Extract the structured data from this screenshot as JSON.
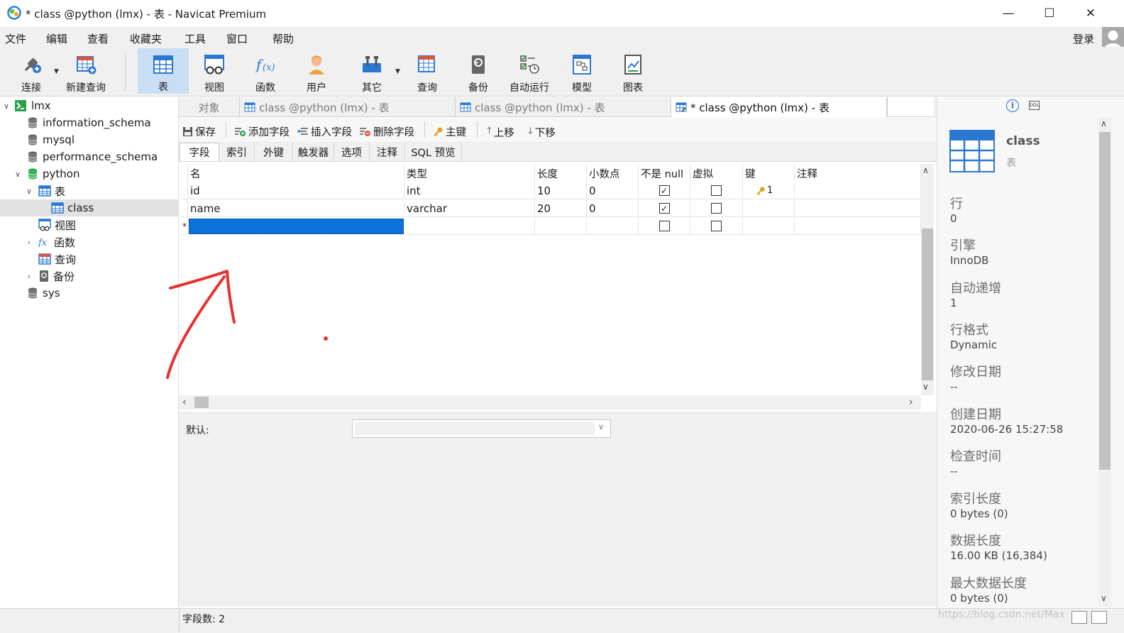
{
  "window": {
    "title": "* class @python (lmx) - 表 - Navicat Premium",
    "min_glyph": "—",
    "max_glyph": "☐",
    "close_glyph": "✕"
  },
  "menu": [
    "文件",
    "编辑",
    "查看",
    "收藏夹",
    "工具",
    "窗口",
    "帮助"
  ],
  "login": "登录",
  "toolbar": [
    {
      "label": "连接",
      "icon": "connect-icon"
    },
    {
      "label": "新建查询",
      "icon": "new-query-icon"
    },
    {
      "label": "表",
      "icon": "table-icon",
      "active": true
    },
    {
      "label": "视图",
      "icon": "view-icon"
    },
    {
      "label": "函数",
      "icon": "function-icon"
    },
    {
      "label": "用户",
      "icon": "user-icon"
    },
    {
      "label": "其它",
      "icon": "tools-icon"
    },
    {
      "label": "查询",
      "icon": "query-icon"
    },
    {
      "label": "备份",
      "icon": "backup-icon"
    },
    {
      "label": "自动运行",
      "icon": "automation-icon"
    },
    {
      "label": "模型",
      "icon": "model-icon"
    },
    {
      "label": "图表",
      "icon": "chart-icon"
    }
  ],
  "tree": [
    {
      "label": "lmx",
      "icon": "connection-icon"
    },
    {
      "label": "information_schema",
      "icon": "database-icon"
    },
    {
      "label": "mysql",
      "icon": "database-icon"
    },
    {
      "label": "performance_schema",
      "icon": "database-icon"
    },
    {
      "label": "python",
      "icon": "database-open-icon"
    },
    {
      "label": "表",
      "icon": "tables-folder-icon"
    },
    {
      "label": "class",
      "icon": "table-item-icon"
    },
    {
      "label": "视图",
      "icon": "views-folder-icon"
    },
    {
      "label": "函数",
      "icon": "functions-folder-icon"
    },
    {
      "label": "查询",
      "icon": "queries-folder-icon"
    },
    {
      "label": "备份",
      "icon": "backups-folder-icon"
    },
    {
      "label": "sys",
      "icon": "database-icon"
    }
  ],
  "tabs": [
    {
      "label": "对象"
    },
    {
      "label": "class @python (lmx) - 表"
    },
    {
      "label": "class @python (lmx) - 表"
    },
    {
      "label": "* class @python (lmx) - 表",
      "active": true
    }
  ],
  "objbar": [
    "保存",
    "添加字段",
    "插入字段",
    "删除字段",
    "主键",
    "上移",
    "下移"
  ],
  "subtabs": [
    "字段",
    "索引",
    "外键",
    "触发器",
    "选项",
    "注释",
    "SQL 预览"
  ],
  "grid": {
    "headers": [
      "名",
      "类型",
      "长度",
      "小数点",
      "不是 null",
      "虚拟",
      "键",
      "注释"
    ],
    "rows": [
      {
        "marker": "",
        "name": "id",
        "type": "int",
        "length": "10",
        "decimals": "0",
        "not_null": true,
        "virtual": false,
        "key": "1"
      },
      {
        "marker": "",
        "name": "name",
        "type": "varchar",
        "length": "20",
        "decimals": "0",
        "not_null": true,
        "virtual": false,
        "key": ""
      },
      {
        "marker": "*",
        "name": "",
        "type": "",
        "length": "",
        "decimals": "",
        "not_null": false,
        "virtual": false,
        "key": ""
      }
    ]
  },
  "default_label": "默认:",
  "status": "字段数: 2",
  "info": {
    "name": "class",
    "kind": "表",
    "props": [
      {
        "label": "行",
        "value": "0"
      },
      {
        "label": "引擎",
        "value": "InnoDB"
      },
      {
        "label": "自动递增",
        "value": "1"
      },
      {
        "label": "行格式",
        "value": "Dynamic"
      },
      {
        "label": "修改日期",
        "value": "--"
      },
      {
        "label": "创建日期",
        "value": "2020-06-26 15:27:58"
      },
      {
        "label": "检查时间",
        "value": "--"
      },
      {
        "label": "索引长度",
        "value": "0 bytes (0)"
      },
      {
        "label": "数据长度",
        "value": "16.00 KB (16,384)"
      },
      {
        "label": "最大数据长度",
        "value": "0 bytes (0)"
      }
    ]
  },
  "watermark": "https://blog.csdn.net/Max",
  "colors": {
    "accent": "#0078d7",
    "selection": "#0a72d8",
    "annotation": "#e8302f"
  }
}
